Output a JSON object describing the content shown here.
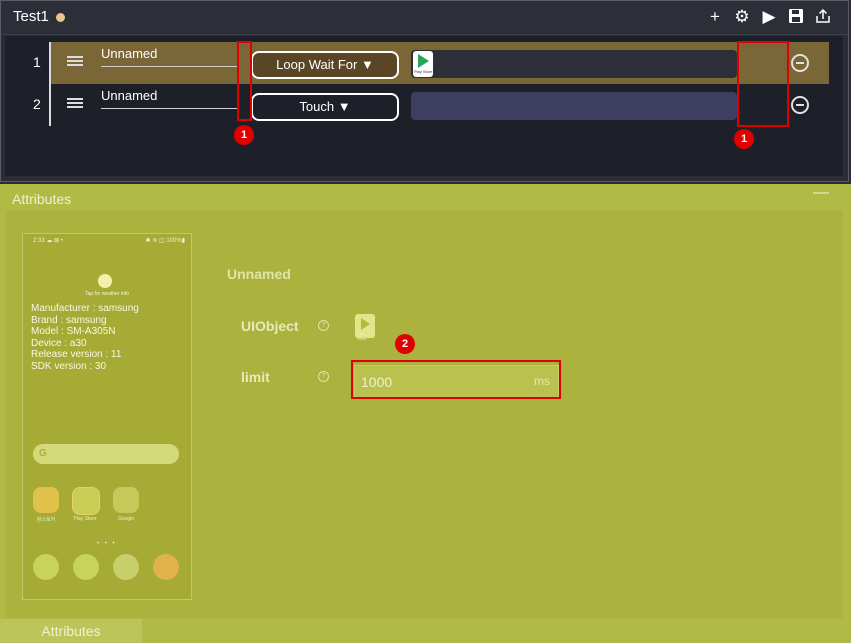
{
  "app": {
    "title": "Test1",
    "unsaved_dot_color": "#e7c38f"
  },
  "toolbar": {
    "icons": [
      "plus-icon",
      "gear-icon",
      "play-icon",
      "save-icon",
      "export-icon"
    ],
    "add": "+",
    "settings": "⚙",
    "run": "▶"
  },
  "steps": [
    {
      "index": "1",
      "name": "Unnamed",
      "action": "Loop Wait For ▼",
      "has_uiobject": true,
      "uiobject_label": "Play Store"
    },
    {
      "index": "2",
      "name": "Unnamed",
      "action": "Touch ▼",
      "has_uiobject": false
    }
  ],
  "markers": {
    "badge1": "1",
    "badge2": "2",
    "color": "#e00000"
  },
  "attributes": {
    "panel_title": "Attributes",
    "minimize": "—",
    "element_name": "Unnamed",
    "uiobject_label": "UIObject",
    "uiobject_icon_label": "Play Store",
    "limit_label": "limit",
    "limit_value": "1000",
    "limit_unit": "ms",
    "help": "?",
    "footer_tab": "Attributes"
  },
  "device": {
    "status_left": "2:33 ☁ ⊠ •",
    "status_right": "✱ ≋ ◫ 100%▮",
    "weather": "Tap for weather info",
    "info": [
      "Manufacturer : samsung",
      "Brand : samsung",
      "Model : SM-A305N",
      "Device : a30",
      "Release version : 11",
      "SDK version : 30"
    ],
    "search_g": "G",
    "apps": [
      "원스토어",
      "Play Store",
      "Google"
    ],
    "page_dots": "• • •"
  }
}
